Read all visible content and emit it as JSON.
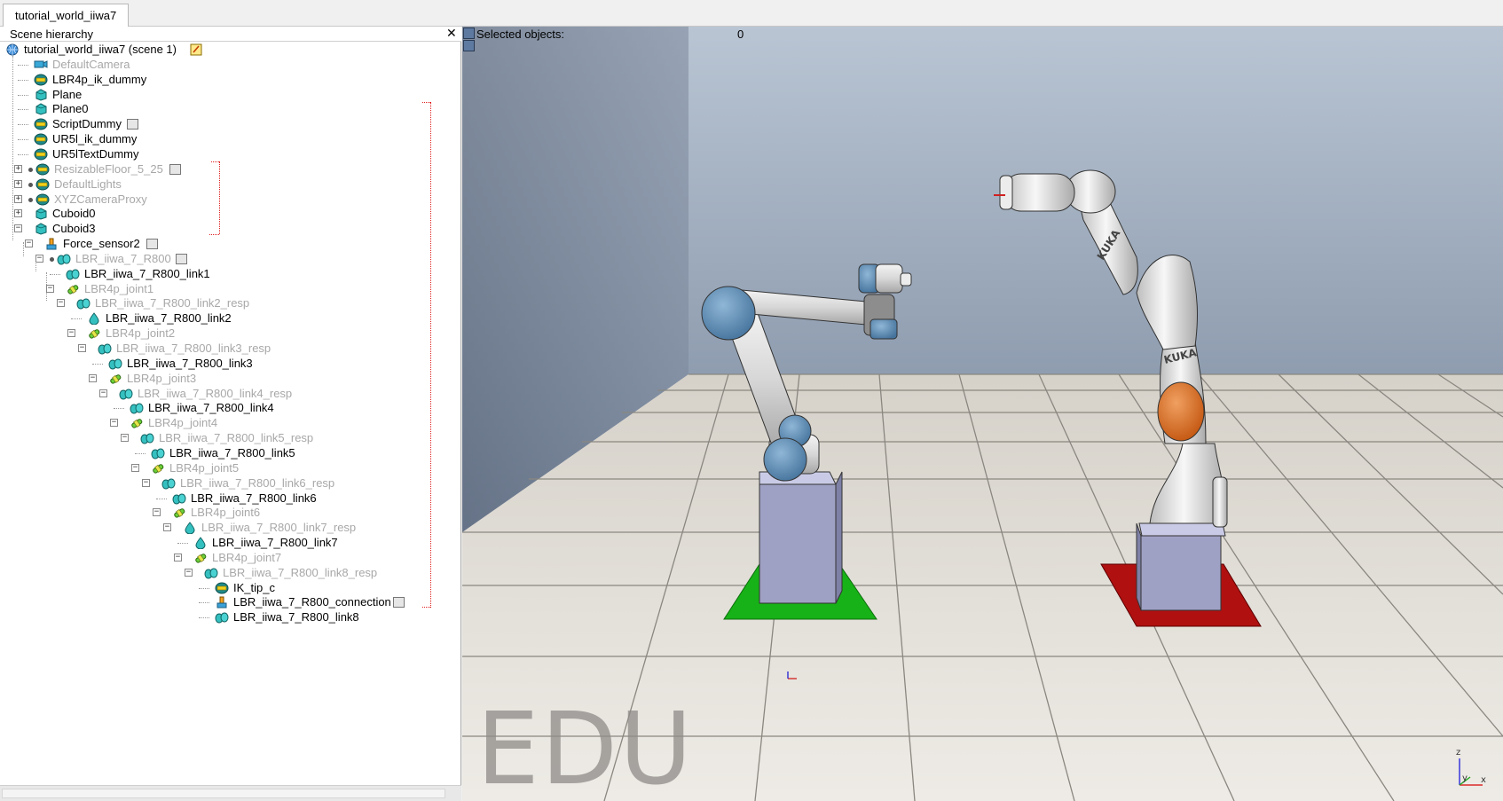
{
  "tab": {
    "label": "tutorial_world_iiwa7"
  },
  "hierarchy": {
    "title": "Scene hierarchy",
    "close_glyph": "✕",
    "rows": [
      {
        "label": "tutorial_world_iiwa7 (scene 1)",
        "icon": "world-icon",
        "level": 0,
        "dim": false
      },
      {
        "label": "DefaultCamera",
        "icon": "camera-icon",
        "level": 1,
        "dim": true
      },
      {
        "label": "LBR4p_ik_dummy",
        "icon": "dummy-icon",
        "level": 1,
        "dim": false
      },
      {
        "label": "Plane",
        "icon": "shape-icon",
        "level": 1,
        "dim": false
      },
      {
        "label": "Plane0",
        "icon": "shape-icon",
        "level": 1,
        "dim": false
      },
      {
        "label": "ScriptDummy",
        "icon": "dummy-icon",
        "level": 1,
        "dim": false
      },
      {
        "label": "UR5l_ik_dummy",
        "icon": "dummy-icon",
        "level": 1,
        "dim": false
      },
      {
        "label": "UR5lTextDummy",
        "icon": "dummy-icon",
        "level": 1,
        "dim": false
      },
      {
        "label": "ResizableFloor_5_25",
        "icon": "dummy-icon",
        "level": 1,
        "dim": true
      },
      {
        "label": "DefaultLights",
        "icon": "dummy-icon",
        "level": 1,
        "dim": true
      },
      {
        "label": "XYZCameraProxy",
        "icon": "dummy-icon",
        "level": 1,
        "dim": true
      },
      {
        "label": "Cuboid0",
        "icon": "shape-icon",
        "level": 1,
        "dim": false
      },
      {
        "label": "Cuboid3",
        "icon": "shape-icon",
        "level": 1,
        "dim": false
      },
      {
        "label": "Force_sensor2",
        "icon": "force-sensor-icon",
        "level": 2,
        "dim": false
      },
      {
        "label": "LBR_iiwa_7_R800",
        "icon": "compound-shape-icon",
        "level": 3,
        "dim": true
      },
      {
        "label": "LBR_iiwa_7_R800_link1",
        "icon": "compound-shape-icon",
        "level": 4,
        "dim": false
      },
      {
        "label": "LBR4p_joint1",
        "icon": "joint-icon",
        "level": 4,
        "dim": true
      },
      {
        "label": "LBR_iiwa_7_R800_link2_resp",
        "icon": "compound-shape-icon",
        "level": 5,
        "dim": true
      },
      {
        "label": "LBR_iiwa_7_R800_link2",
        "icon": "shape-drop-icon",
        "level": 6,
        "dim": false
      },
      {
        "label": "LBR4p_joint2",
        "icon": "joint-icon",
        "level": 6,
        "dim": true
      },
      {
        "label": "LBR_iiwa_7_R800_link3_resp",
        "icon": "compound-shape-icon",
        "level": 7,
        "dim": true
      },
      {
        "label": "LBR_iiwa_7_R800_link3",
        "icon": "compound-shape-icon",
        "level": 8,
        "dim": false
      },
      {
        "label": "LBR4p_joint3",
        "icon": "joint-icon",
        "level": 8,
        "dim": true
      },
      {
        "label": "LBR_iiwa_7_R800_link4_resp",
        "icon": "compound-shape-icon",
        "level": 9,
        "dim": true
      },
      {
        "label": "LBR_iiwa_7_R800_link4",
        "icon": "compound-shape-icon",
        "level": 10,
        "dim": false
      },
      {
        "label": "LBR4p_joint4",
        "icon": "joint-icon",
        "level": 10,
        "dim": true
      },
      {
        "label": "LBR_iiwa_7_R800_link5_resp",
        "icon": "compound-shape-icon",
        "level": 11,
        "dim": true
      },
      {
        "label": "LBR_iiwa_7_R800_link5",
        "icon": "compound-shape-icon",
        "level": 12,
        "dim": false
      },
      {
        "label": "LBR4p_joint5",
        "icon": "joint-icon",
        "level": 12,
        "dim": true
      },
      {
        "label": "LBR_iiwa_7_R800_link6_resp",
        "icon": "compound-shape-icon",
        "level": 13,
        "dim": true
      },
      {
        "label": "LBR_iiwa_7_R800_link6",
        "icon": "compound-shape-icon",
        "level": 14,
        "dim": false
      },
      {
        "label": "LBR4p_joint6",
        "icon": "joint-icon",
        "level": 14,
        "dim": true
      },
      {
        "label": "LBR_iiwa_7_R800_link7_resp",
        "icon": "shape-drop-icon",
        "level": 15,
        "dim": true
      },
      {
        "label": "LBR_iiwa_7_R800_link7",
        "icon": "shape-drop-icon",
        "level": 16,
        "dim": false
      },
      {
        "label": "LBR4p_joint7",
        "icon": "joint-icon",
        "level": 16,
        "dim": true
      },
      {
        "label": "LBR_iiwa_7_R800_link8_resp",
        "icon": "compound-shape-icon",
        "level": 17,
        "dim": true
      },
      {
        "label": "IK_tip_c",
        "icon": "dummy-icon",
        "level": 18,
        "dim": false
      },
      {
        "label": "LBR_iiwa_7_R800_connection",
        "icon": "force-sensor-icon",
        "level": 18,
        "dim": false
      },
      {
        "label": "LBR_iiwa_7_R800_link8",
        "icon": "compound-shape-icon",
        "level": 18,
        "dim": false
      }
    ]
  },
  "viewport": {
    "selected_label": "Selected objects:",
    "selected_count": "0",
    "watermark": "EDU",
    "robot_brand": "KUKA",
    "colors": {
      "sky_top": "#b8c4d2",
      "sky_bottom": "#5c6d86",
      "floor_light": "#ece9e3",
      "floor_dark": "#d9d5cd",
      "green_pad": "#17b217",
      "red_pad": "#b01010",
      "pedestal": "#9fa1c4",
      "ur5_joint": "#5d8cb4",
      "kuka_orange": "#d9681e"
    }
  }
}
